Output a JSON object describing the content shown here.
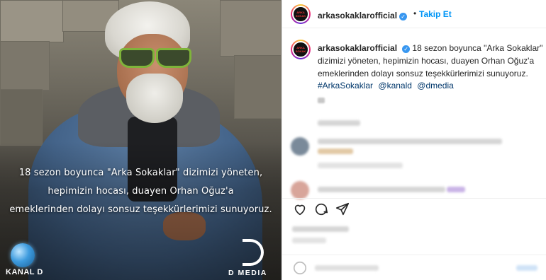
{
  "media": {
    "overlay_lines": [
      "18 sezon boyunca \"Arka Sokaklar\" dizimizi yöneten,",
      "hepimizin hocası, duayen Orhan Oğuz'a",
      "emeklerinden dolayı sonsuz teşekkürlerimizi sunuyoruz."
    ],
    "logo_left": "KANAL D",
    "logo_right": "D MEDIA"
  },
  "post": {
    "account": "arkasokaklarofficial",
    "follow_separator": "•",
    "follow_label": "Takip Et",
    "caption_text": "18 sezon boyunca \"Arka Sokaklar\" dizimizi yöneten, hepimizin hocası, duayen Orhan Oğuz'a emeklerinden dolayı sonsuz teşekkürlerimizi sunuyoruz.",
    "hashtags": [
      "#ArkaSokaklar",
      "@kanald",
      "@dmedia"
    ],
    "verified_glyph": "✓"
  },
  "colors": {
    "link": "#00376b",
    "follow": "#0095f6",
    "verified": "#3897f0"
  },
  "icons": [
    "heart-icon",
    "comment-icon",
    "share-icon"
  ]
}
